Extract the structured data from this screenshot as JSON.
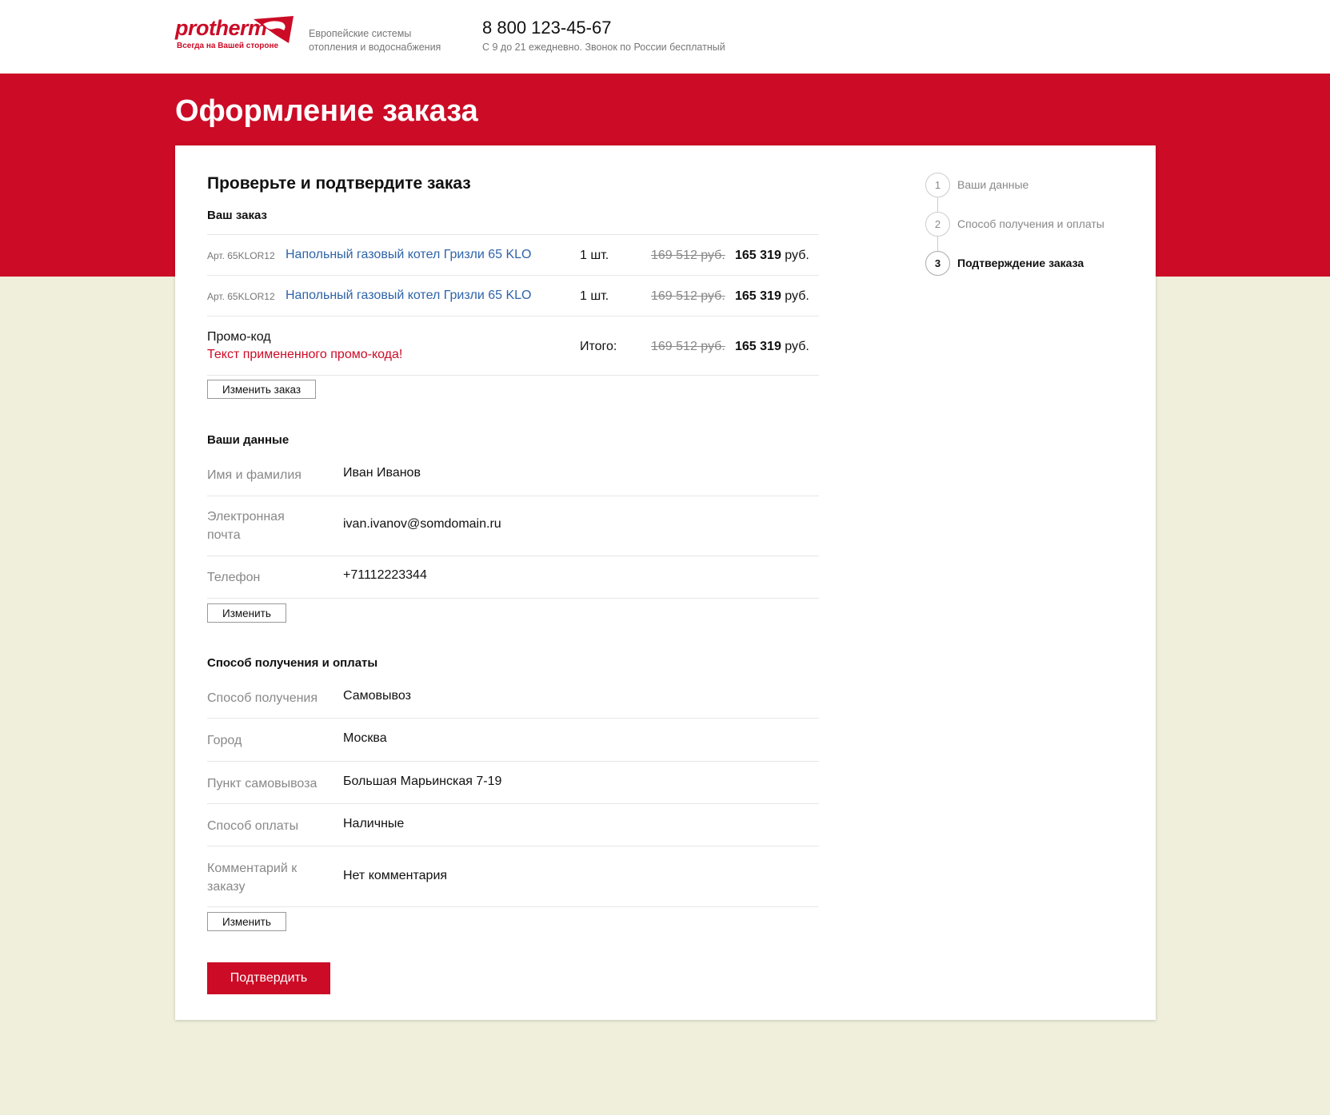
{
  "header": {
    "logo_text": "protherm",
    "logo_tagline": "Всегда на Вашей стороне",
    "tagline": "Европейские системы отопления и водоснабжения",
    "phone": "8 800 123-45-67",
    "hours": "С 9 до 21 ежедневно. Звонок по России бесплатный"
  },
  "page": {
    "title": "Оформление заказа"
  },
  "order": {
    "section_title": "Проверьте и подтвердите заказ",
    "subtitle": "Ваш заказ",
    "items": [
      {
        "art": "Арт. 65KLOR12",
        "name": "Напольный газовый котел Гризли 65 KLO",
        "qty": "1 шт.",
        "old_price": "169 512 руб.",
        "price": "165 319",
        "currency": "руб."
      },
      {
        "art": "Арт. 65KLOR12",
        "name": "Напольный газовый котел Гризли 65 KLO",
        "qty": "1 шт.",
        "old_price": "169 512 руб.",
        "price": "165 319",
        "currency": "руб."
      }
    ],
    "promo_label": "Промо-код",
    "promo_text": "Текст примененного промо-кода!",
    "total_label": "Итого:",
    "total_old": "169 512 руб.",
    "total_price": "165 319",
    "total_currency": "руб.",
    "change_button": "Изменить заказ"
  },
  "customer": {
    "subtitle": "Ваши данные",
    "fields": [
      {
        "label": "Имя и фамилия",
        "value": "Иван Иванов"
      },
      {
        "label": "Электронная почта",
        "value": "ivan.ivanov@somdomain.ru"
      },
      {
        "label": "Телефон",
        "value": "+71112223344"
      }
    ],
    "change_button": "Изменить"
  },
  "delivery": {
    "subtitle": "Способ получения и оплаты",
    "fields": [
      {
        "label": "Способ получения",
        "value": "Самовывоз"
      },
      {
        "label": "Город",
        "value": "Москва"
      },
      {
        "label": "Пункт самовывоза",
        "value": "Большая Марьинская 7-19"
      },
      {
        "label": "Способ оплаты",
        "value": "Наличные"
      },
      {
        "label": "Комментарий к заказу",
        "value": "Нет комментария"
      }
    ],
    "change_button": "Изменить"
  },
  "confirm_button": "Подтвердить",
  "steps": [
    {
      "number": "1",
      "label": "Ваши данные"
    },
    {
      "number": "2",
      "label": "Способ получения и оплаты"
    },
    {
      "number": "3",
      "label": "Подтверждение заказа"
    }
  ],
  "colors": {
    "brand_red": "#cc0b26",
    "link_blue": "#2f64a8",
    "page_bg": "#efefdc"
  }
}
